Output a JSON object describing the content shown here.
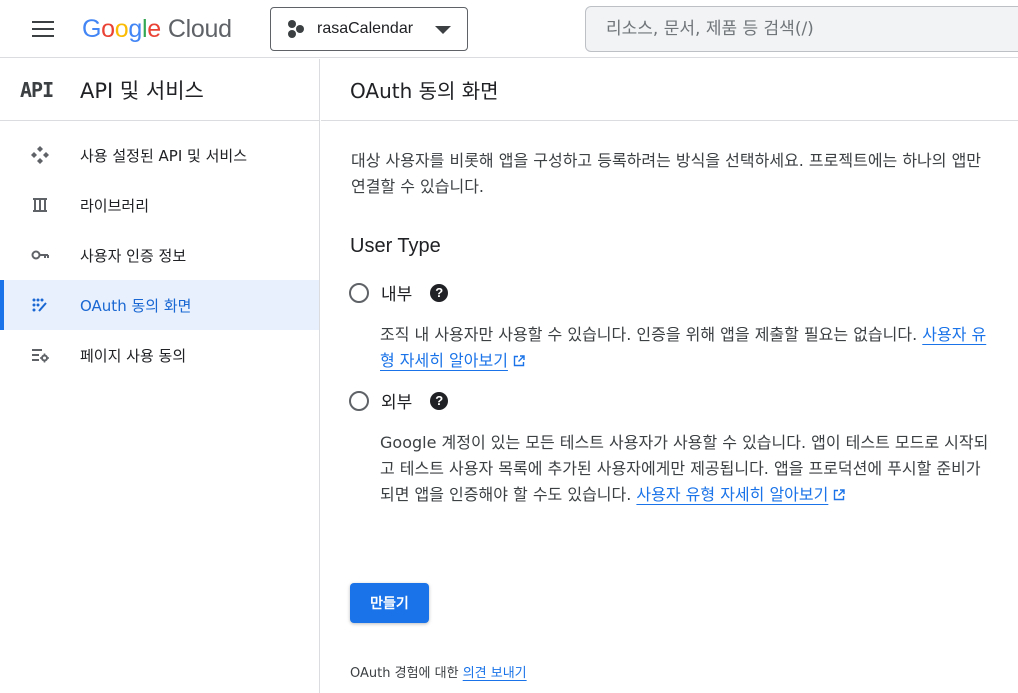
{
  "header": {
    "logo_google_letters": [
      "G",
      "o",
      "o",
      "g",
      "l",
      "e"
    ],
    "logo_google_colors": [
      "#4285F4",
      "#EA4335",
      "#FBBC05",
      "#4285F4",
      "#34A853",
      "#EA4335"
    ],
    "logo_cloud": "Cloud",
    "project_name": "rasaCalendar",
    "search_placeholder": "리소스, 문서, 제품 등 검색(/)"
  },
  "sidebar": {
    "badge": "API",
    "title": "API 및 서비스",
    "items": [
      {
        "label": "사용 설정된 API 및 서비스",
        "icon": "enabled-apis-icon"
      },
      {
        "label": "라이브러리",
        "icon": "library-icon"
      },
      {
        "label": "사용자 인증 정보",
        "icon": "key-icon"
      },
      {
        "label": "OAuth 동의 화면",
        "icon": "oauth-consent-icon",
        "active": true
      },
      {
        "label": "페이지 사용 동의",
        "icon": "page-usage-agreement-icon"
      }
    ]
  },
  "main": {
    "title": "OAuth 동의 화면",
    "intro": "대상 사용자를 비롯해 앱을 구성하고 등록하려는 방식을 선택하세요. 프로젝트에는 하나의 앱만 연결할 수 있습니다.",
    "user_type_heading": "User Type",
    "options": [
      {
        "label": "내부",
        "description": "조직 내 사용자만 사용할 수 있습니다. 인증을 위해 앱을 제출할 필요는 없습니다.",
        "link": "사용자 유형 자세히 알아보기"
      },
      {
        "label": "외부",
        "description": "Google 계정이 있는 모든 테스트 사용자가 사용할 수 있습니다. 앱이 테스트 모드로 시작되고 테스트 사용자 목록에 추가된 사용자에게만 제공됩니다. 앱을 프로덕션에 푸시할 준비가 되면 앱을 인증해야 할 수도 있습니다.",
        "link": "사용자 유형 자세히 알아보기"
      }
    ],
    "help_glyph": "?",
    "create_button": "만들기",
    "feedback_text": "OAuth 경험에 대한",
    "feedback_link": "의견 보내기"
  },
  "colors": {
    "accent": "#1a73e8",
    "active_bg": "#e8f0fe",
    "text": "#202124"
  }
}
